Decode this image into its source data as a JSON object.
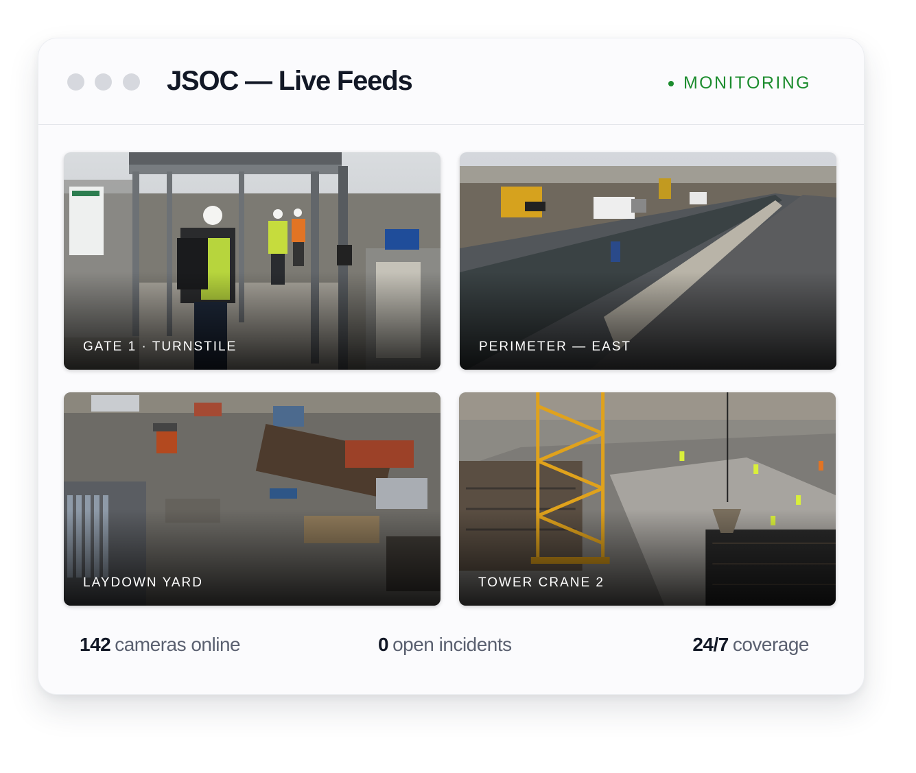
{
  "window": {
    "title": "JSOC — Live Feeds",
    "status": "MONITORING",
    "status_color": "#1c8c2e"
  },
  "feeds": [
    {
      "label": "GATE 1 · TURNSTILE",
      "scene": "turnstile-gate"
    },
    {
      "label": "PERIMETER — EAST",
      "scene": "perimeter-fence-road"
    },
    {
      "label": "LAYDOWN YARD",
      "scene": "material-storage-yard"
    },
    {
      "label": "TOWER CRANE 2",
      "scene": "crane-foundation-pour"
    }
  ],
  "stats": [
    {
      "value": "142",
      "label": "cameras online"
    },
    {
      "value": "0",
      "label": "open incidents"
    },
    {
      "value": "24/7",
      "label": "coverage"
    }
  ]
}
